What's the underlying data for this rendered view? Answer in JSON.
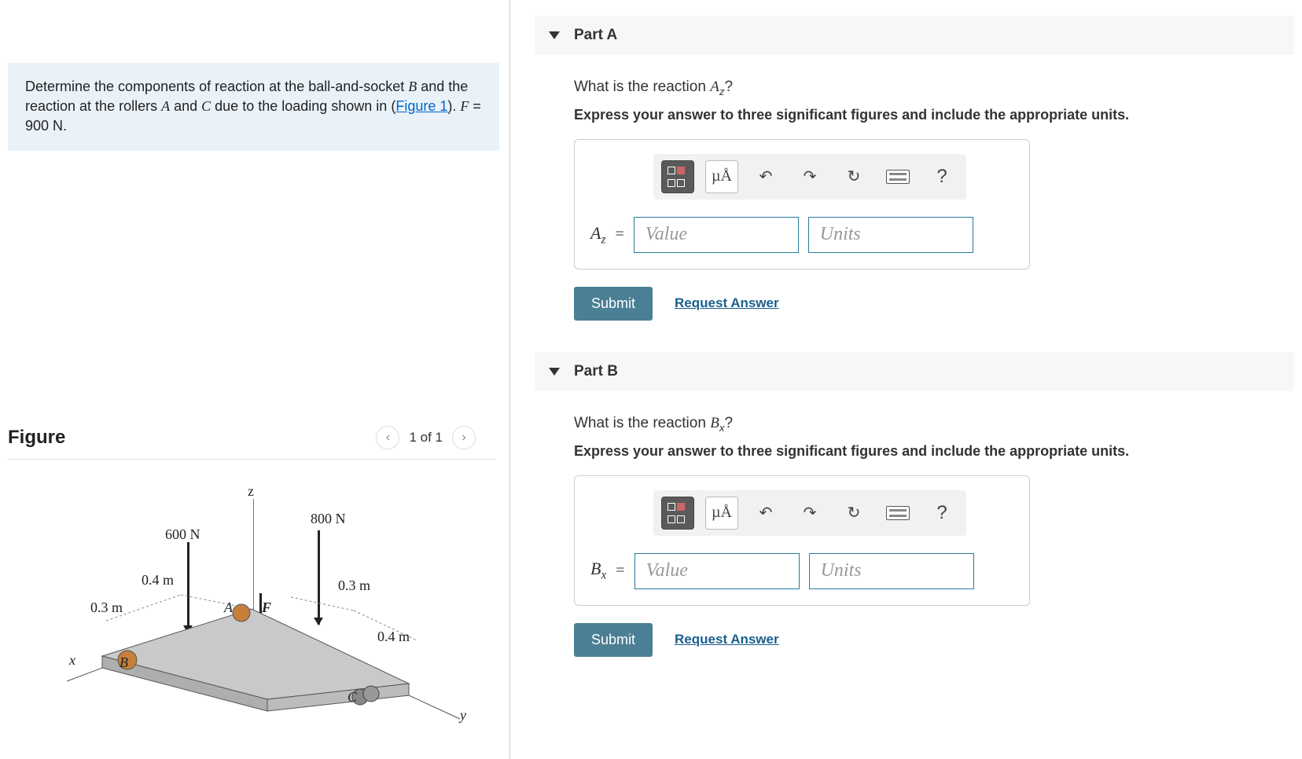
{
  "problem": {
    "text_prefix": "Determine the components of reaction at the ball-and-socket ",
    "B": "B",
    "text_mid1": " and the reaction at the rollers ",
    "A": "A",
    "text_mid2": " and ",
    "C": "C",
    "text_mid3": " due to the loading shown in (",
    "figure_link": "Figure 1",
    "text_after": "). ",
    "F": "F",
    "F_eq": " = 900 N."
  },
  "figure": {
    "heading": "Figure",
    "pager": "1 of 1",
    "labels": {
      "z": "z",
      "x": "x",
      "y": "y",
      "A": "A",
      "B": "B",
      "C": "C",
      "F": "F",
      "f600": "600 N",
      "f800": "800 N",
      "d04a": "0.4 m",
      "d03a": "0.3 m",
      "d03b": "0.3 m",
      "d04b": "0.4 m"
    }
  },
  "partA": {
    "title": "Part A",
    "prompt_pre": "What is the reaction ",
    "var": "A",
    "var_sub": "z",
    "prompt_post": "?",
    "instr": "Express your answer to three significant figures and include the appropriate units.",
    "label_var": "A",
    "label_sub": "z",
    "eq": " = ",
    "value_ph": "Value",
    "units_ph": "Units",
    "submit": "Submit",
    "request": "Request Answer"
  },
  "partB": {
    "title": "Part B",
    "prompt_pre": "What is the reaction ",
    "var": "B",
    "var_sub": "x",
    "prompt_post": "?",
    "instr": "Express your answer to three significant figures and include the appropriate units.",
    "label_var": "B",
    "label_sub": "x",
    "eq": " = ",
    "value_ph": "Value",
    "units_ph": "Units",
    "submit": "Submit",
    "request": "Request Answer"
  },
  "toolbar": {
    "mu": "µÅ",
    "help": "?"
  }
}
